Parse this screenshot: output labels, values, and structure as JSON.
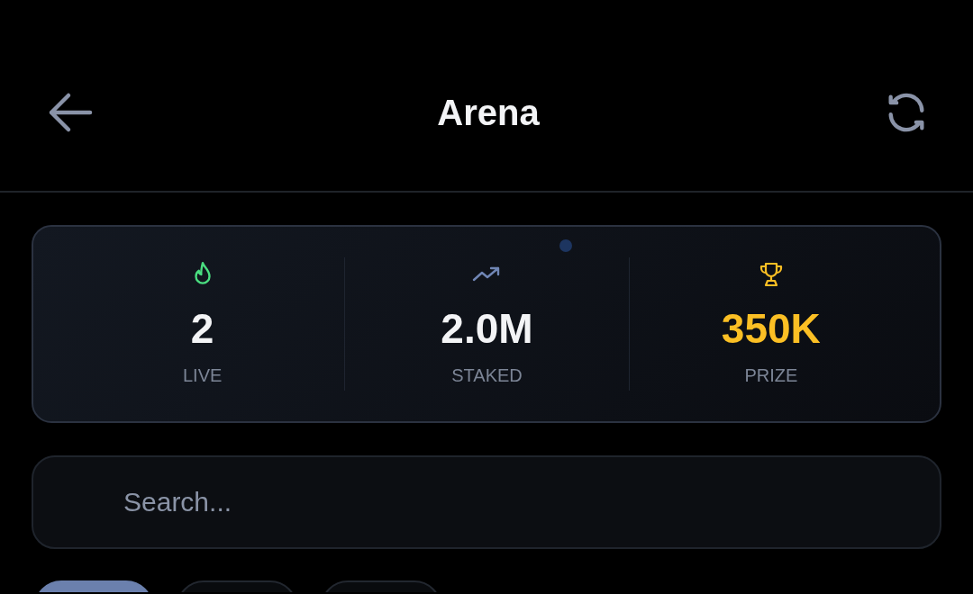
{
  "header": {
    "title": "Arena"
  },
  "stats": [
    {
      "kind": "live",
      "value": "2",
      "label": "LIVE"
    },
    {
      "kind": "staked",
      "value": "2.0M",
      "label": "STAKED"
    },
    {
      "kind": "prize",
      "value": "350K",
      "label": "PRIZE"
    }
  ],
  "search": {
    "placeholder": "Search..."
  },
  "filter_chips": [
    {
      "selected": true
    },
    {
      "selected": false
    },
    {
      "selected": false
    }
  ]
}
